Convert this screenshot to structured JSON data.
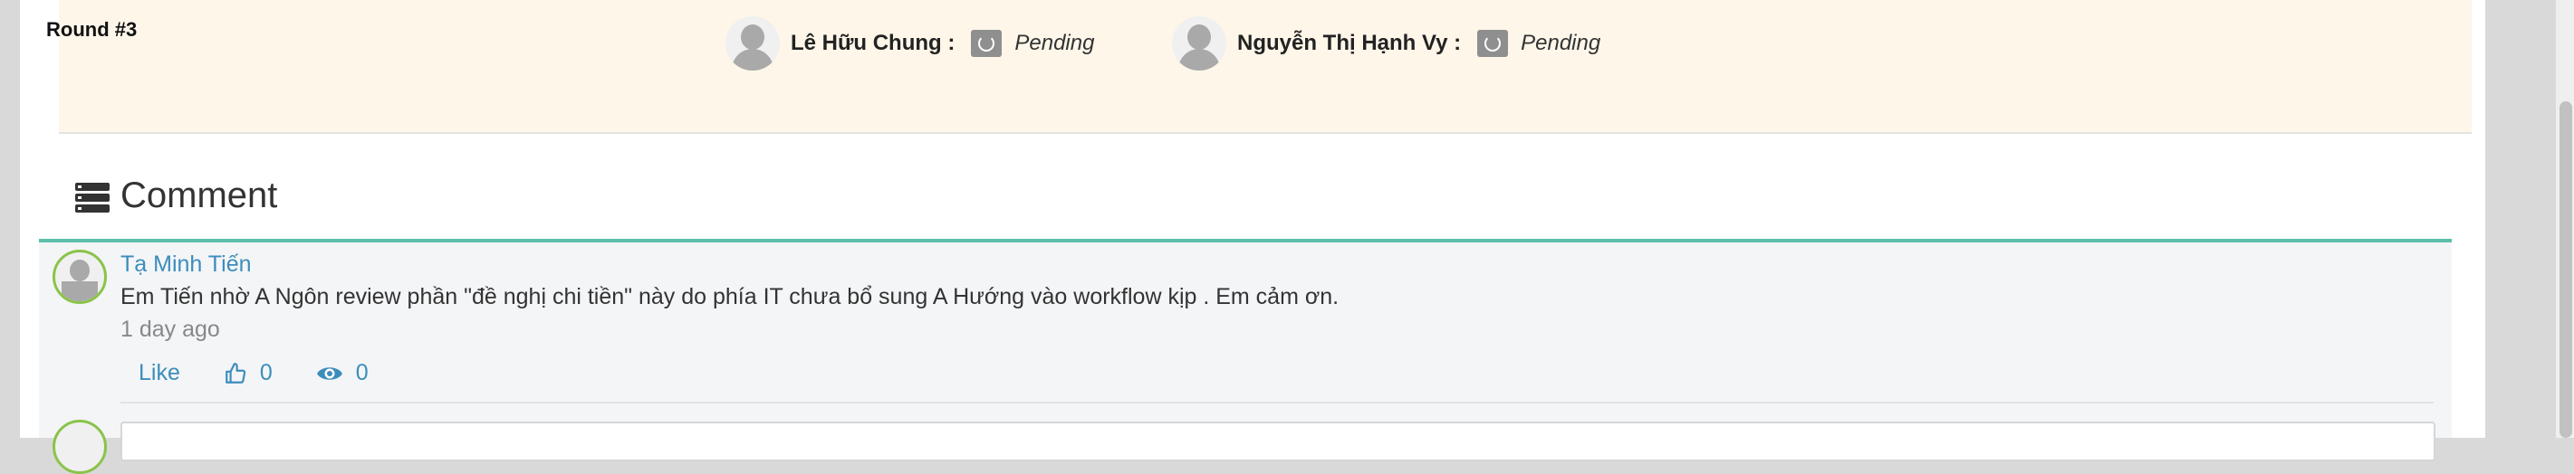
{
  "approval_round": {
    "label": "Round #3",
    "approvers": [
      {
        "name": "Lê Hữu Chung :",
        "status": "Pending",
        "status_icon": "pending-spinner-icon"
      },
      {
        "name": "Nguyễn Thị Hạnh Vy :",
        "status": "Pending",
        "status_icon": "pending-spinner-icon"
      }
    ]
  },
  "comments_section": {
    "title": "Comment",
    "icon": "server-list-icon",
    "items": [
      {
        "author": "Tạ Minh Tiến",
        "text": "Em Tiến nhờ A Ngôn review phần \"đề nghị chi tiền\" này do phía IT chưa bổ sung A Hướng vào workflow kịp . Em cảm ơn.",
        "time": "1 day ago",
        "like_label": "Like",
        "likes": "0",
        "views": "0"
      }
    ]
  },
  "colors": {
    "round_background": "#fdf6e9",
    "accent_border": "#5bbfaa",
    "link": "#3c8dbc",
    "comment_background": "#f4f5f7"
  }
}
